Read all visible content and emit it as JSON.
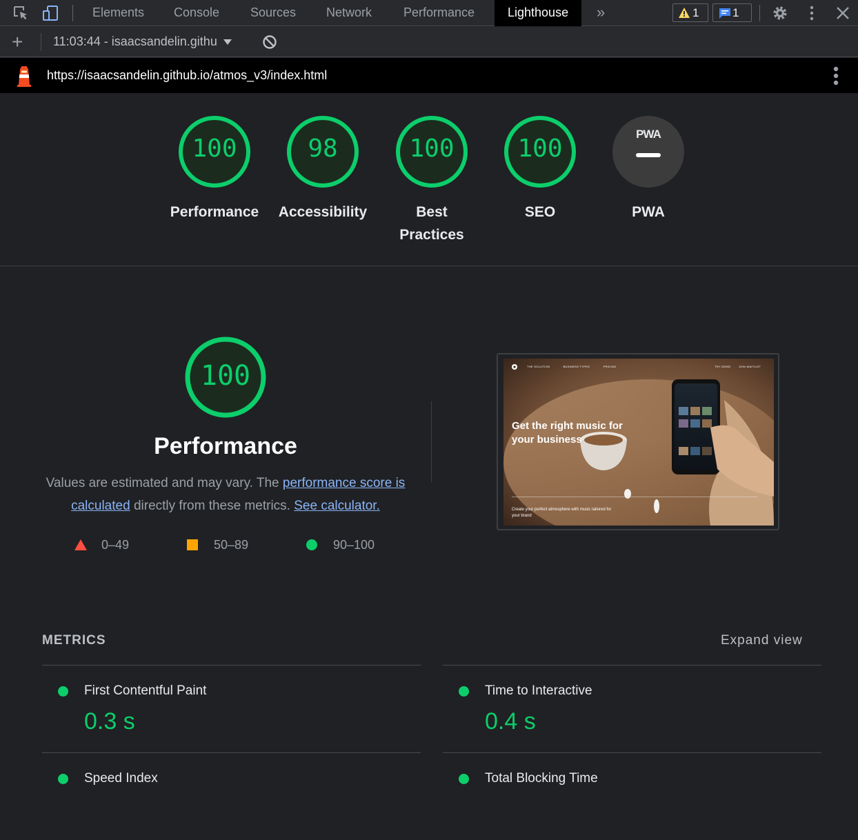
{
  "devtools": {
    "tabs": [
      "Elements",
      "Console",
      "Sources",
      "Network",
      "Performance",
      "Lighthouse"
    ],
    "active_tab": "Lighthouse",
    "more_tabs": "»",
    "warnings_count": "1",
    "messages_count": "1"
  },
  "toolbar": {
    "add": "+",
    "report_select": "11:03:44 - isaacsandelin.githu"
  },
  "url": "https://isaacsandelin.github.io/atmos_v3/index.html",
  "gauges": [
    {
      "score": "100",
      "label": "Performance"
    },
    {
      "score": "98",
      "label": "Accessibility"
    },
    {
      "score": "100",
      "label": "Best Practices"
    },
    {
      "score": "100",
      "label": "SEO"
    },
    {
      "score": "",
      "label": "PWA",
      "badge": "PWA"
    }
  ],
  "performance": {
    "score": "100",
    "title": "Performance",
    "desc_1": "Values are estimated and may vary. The ",
    "link_score": "performance score is calculated",
    "desc_2": " directly from these metrics. ",
    "link_calc": "See calculator.",
    "legend": [
      {
        "range": "0–49"
      },
      {
        "range": "50–89"
      },
      {
        "range": "90–100"
      }
    ]
  },
  "screenshot": {
    "nav": [
      "THE SOLUTION",
      "BUSINESS TYPES",
      "PRICING",
      "TRY DEMO",
      "JOIN WAITLIST"
    ],
    "headline": "Get the right music for your business",
    "sub": "Create your perfect atmosphere with music tailored for your brand"
  },
  "metrics": {
    "title": "METRICS",
    "expand": "Expand view",
    "items": [
      {
        "label": "First Contentful Paint",
        "value": "0.3 s"
      },
      {
        "label": "Time to Interactive",
        "value": "0.4 s"
      },
      {
        "label": "Speed Index",
        "value": ""
      },
      {
        "label": "Total Blocking Time",
        "value": ""
      }
    ]
  },
  "colors": {
    "pass": "#0cce6b",
    "average": "#ffa400",
    "fail": "#ff4e42",
    "link": "#8ab4f8"
  }
}
